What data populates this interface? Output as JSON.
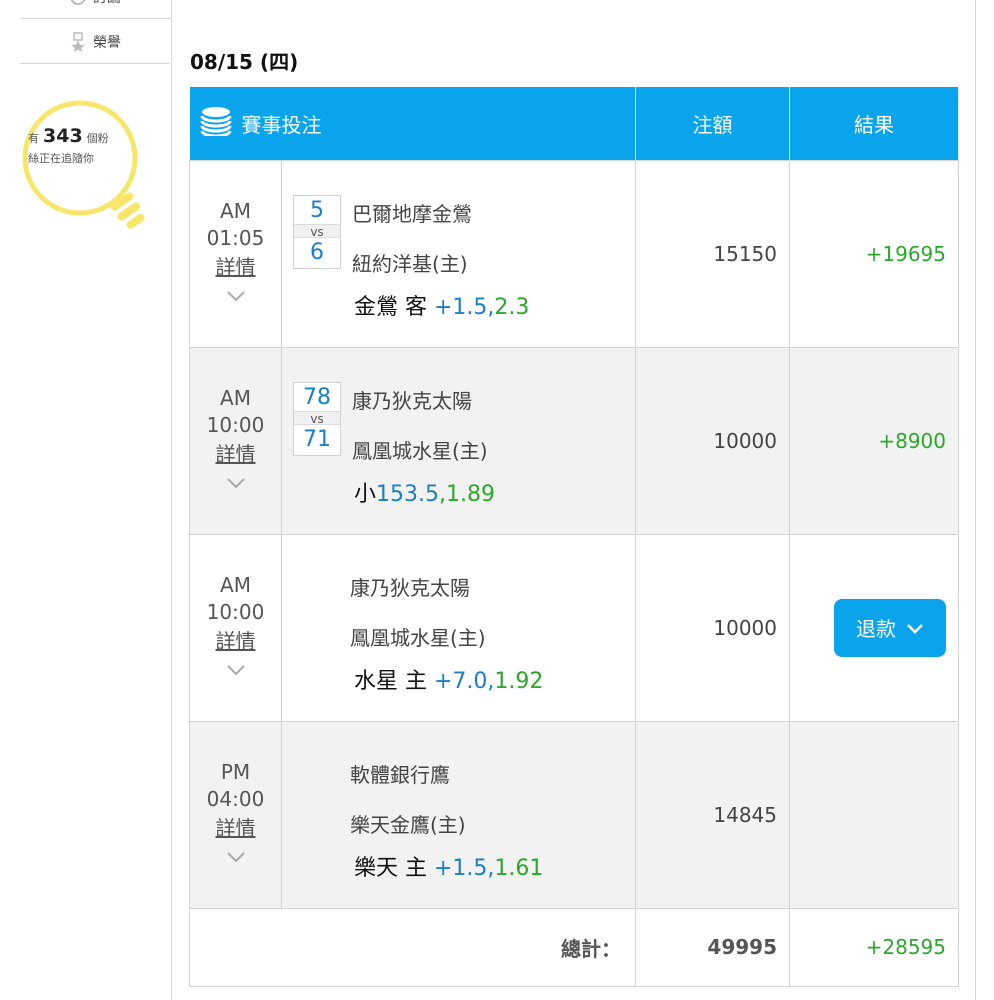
{
  "sidebar": {
    "top_item_label": "討論",
    "honor_label": "榮譽",
    "fans_prefix": "有",
    "fans_count": "343",
    "fans_suffix": "個粉",
    "fans_line2": "絲正在追隨你"
  },
  "date": "08/15 (四)",
  "table": {
    "headers": {
      "event": "賽事投注",
      "amount": "注額",
      "result": "結果"
    },
    "detail_label": "詳情",
    "rows": [
      {
        "period": "AM",
        "time": "01:05",
        "score_away": "5",
        "vs": "vs",
        "score_home": "6",
        "team_away": "巴爾地摩金鶯",
        "team_home": "紐約洋基(主)",
        "bet_name": "金鶯 客",
        "bet_line": "+1.5",
        "bet_sep": ",",
        "bet_odds": "2.3",
        "amount": "15150",
        "result": "+19695"
      },
      {
        "period": "AM",
        "time": "10:00",
        "score_away": "78",
        "vs": "vs",
        "score_home": "71",
        "team_away": "康乃狄克太陽",
        "team_home": "鳳凰城水星(主)",
        "bet_name": "小",
        "bet_line": "153.5",
        "bet_sep": ",",
        "bet_odds": "1.89",
        "amount": "10000",
        "result": "+8900"
      },
      {
        "period": "AM",
        "time": "10:00",
        "team_away": "康乃狄克太陽",
        "team_home": "鳳凰城水星(主)",
        "bet_name": "水星 主",
        "bet_line": "+7.0",
        "bet_sep": ",",
        "bet_odds": "1.92",
        "amount": "10000",
        "result_button": "退款"
      },
      {
        "period": "PM",
        "time": "04:00",
        "team_away": "軟體銀行鷹",
        "team_home": "樂天金鷹(主)",
        "bet_name": "樂天 主",
        "bet_line": "+1.5",
        "bet_sep": ",",
        "bet_odds": "1.61",
        "amount": "14845",
        "result": ""
      }
    ],
    "total_label": "總計：",
    "total_amount": "49995",
    "total_result": "+28595"
  },
  "colors": {
    "header_blue": "#0aa4ec",
    "win_green": "#2aa82a",
    "score_blue": "#1a7fc4",
    "bulb_yellow": "#f7e66a"
  }
}
